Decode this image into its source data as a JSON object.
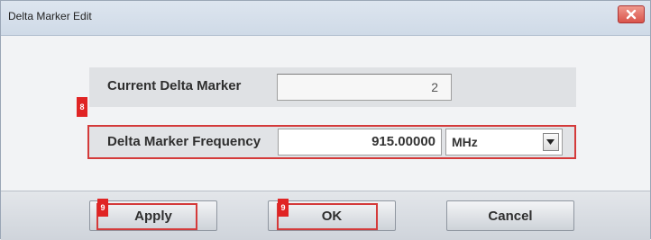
{
  "window": {
    "title": "Delta Marker Edit"
  },
  "fields": {
    "current_delta_marker": {
      "label": "Current Delta Marker",
      "value": "2"
    },
    "delta_marker_frequency": {
      "label": "Delta Marker Frequency",
      "value": "915.00000",
      "unit": "MHz"
    }
  },
  "buttons": {
    "apply": "Apply",
    "ok": "OK",
    "cancel": "Cancel"
  },
  "annotations": {
    "badge_frequency": "8",
    "badge_apply": "9",
    "badge_ok": "9"
  },
  "colors": {
    "highlight": "#d43a3a",
    "badge": "#e02424",
    "close_button": "#d9534a"
  }
}
